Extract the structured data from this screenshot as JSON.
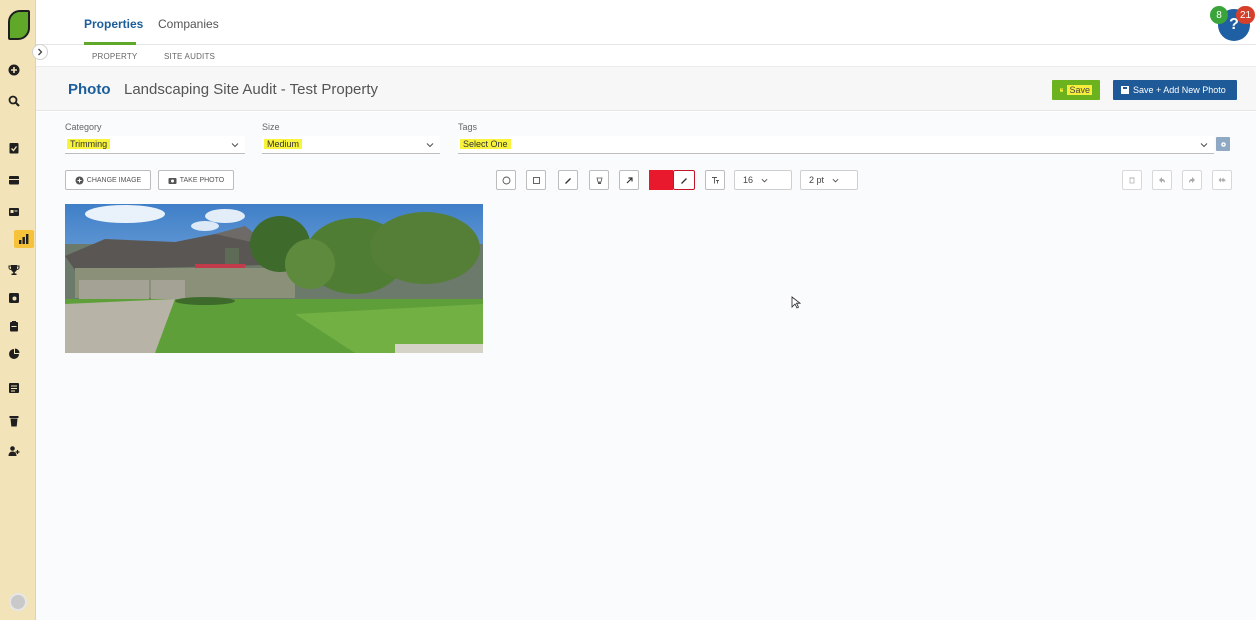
{
  "sidebar": {
    "icons": [
      "plus-circle-icon",
      "search-icon",
      "clipboard-check-icon",
      "wallet-icon",
      "id-card-icon",
      "bar-chart-icon",
      "trophy-icon",
      "camera-square-icon",
      "clipboard-icon",
      "pie-chart-icon",
      "list-icon",
      "trash-can-icon",
      "user-plus-icon"
    ],
    "active_index": 5
  },
  "topbar": {
    "tabs": [
      {
        "label": "Properties",
        "active": true
      },
      {
        "label": "Companies",
        "active": false
      }
    ],
    "help_icon": "?",
    "badge_green": "8",
    "badge_red": "21"
  },
  "subnav": {
    "items": [
      "PROPERTY",
      "SITE AUDITS"
    ]
  },
  "header": {
    "title": "Photo",
    "subtitle": "Landscaping Site Audit - Test Property",
    "save_label": "Save",
    "save_add_label": "Save + Add New Photo"
  },
  "form": {
    "category": {
      "label": "Category",
      "value": "Trimming"
    },
    "size": {
      "label": "Size",
      "value": "Medium"
    },
    "tags": {
      "label": "Tags",
      "value": "Select One"
    }
  },
  "toolbar": {
    "change_image_label": "CHANGE IMAGE",
    "take_photo_label": "TAKE PHOTO",
    "font_size": "16",
    "stroke_width": "2 pt",
    "color": "#e8192c"
  },
  "colors": {
    "brand_blue": "#1b5e9a",
    "brand_green": "#6cb21f",
    "sidebar_bg": "#f3e3b8",
    "highlight": "#f7f43b"
  }
}
